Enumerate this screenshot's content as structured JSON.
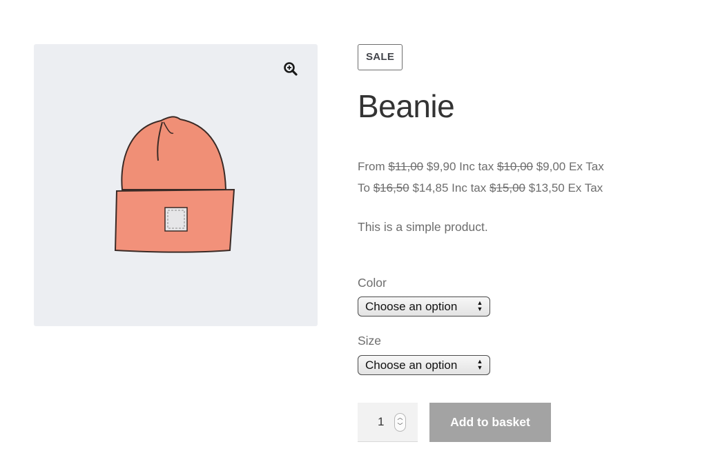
{
  "product": {
    "badge": "SALE",
    "title": "Beanie",
    "price_line_1": {
      "prefix": "From",
      "regular_inc": "$11,00",
      "sale_inc": "$9,90",
      "inc_suffix": "Inc tax",
      "regular_ex": "$10,00",
      "sale_ex": "$9,00",
      "ex_suffix": "Ex Tax"
    },
    "price_line_2": {
      "prefix": "To",
      "regular_inc": "$16,50",
      "sale_inc": "$14,85",
      "inc_suffix": "Inc tax",
      "regular_ex": "$15,00",
      "sale_ex": "$13,50",
      "ex_suffix": "Ex Tax"
    },
    "description": "This is a simple product."
  },
  "variations": {
    "color_label": "Color",
    "color_value": "Choose an option",
    "size_label": "Size",
    "size_value": "Choose an option"
  },
  "cart": {
    "quantity": "1",
    "add_label": "Add to basket"
  },
  "icons": {
    "zoom": "zoom-in-icon",
    "select_arrows": "up-down-arrows-icon",
    "spinner": "spinner-arrows-icon"
  },
  "colors": {
    "button_bg": "#a3a3a3",
    "gallery_bg": "#eceef2",
    "beanie": "#f08f76"
  }
}
